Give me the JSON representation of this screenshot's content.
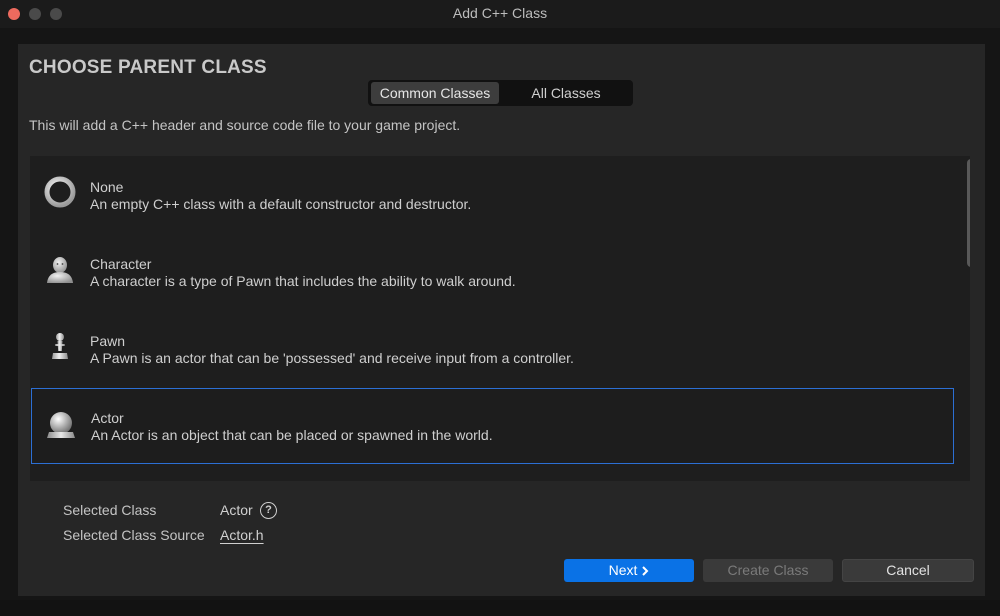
{
  "window": {
    "title": "Add C++ Class"
  },
  "heading": "CHOOSE PARENT CLASS",
  "tabs": [
    {
      "label": "Common Classes",
      "selected": true
    },
    {
      "label": "All Classes",
      "selected": false
    }
  ],
  "description": "This will add a C++ header and source code file to your game project.",
  "classes": [
    {
      "name": "None",
      "description": "An empty C++ class with a default constructor and destructor.",
      "icon": "ring-icon"
    },
    {
      "name": "Character",
      "description": "A character is a type of Pawn that includes the ability to walk around.",
      "icon": "character-icon"
    },
    {
      "name": "Pawn",
      "description": "A Pawn is an actor that can be 'possessed' and receive input from a controller.",
      "icon": "pawn-icon"
    },
    {
      "name": "Actor",
      "description": "An Actor is an object that can be placed or spawned in the world.",
      "icon": "actor-icon",
      "selected": true
    }
  ],
  "selection": {
    "class_label": "Selected Class",
    "class_value": "Actor",
    "source_label": "Selected Class Source",
    "source_value": "Actor.h"
  },
  "buttons": {
    "next": "Next",
    "create": "Create Class",
    "cancel": "Cancel"
  },
  "colors": {
    "accent": "#0a72e6",
    "selection_border": "#2c6fd4",
    "close_dot": "#ed6a5e"
  }
}
